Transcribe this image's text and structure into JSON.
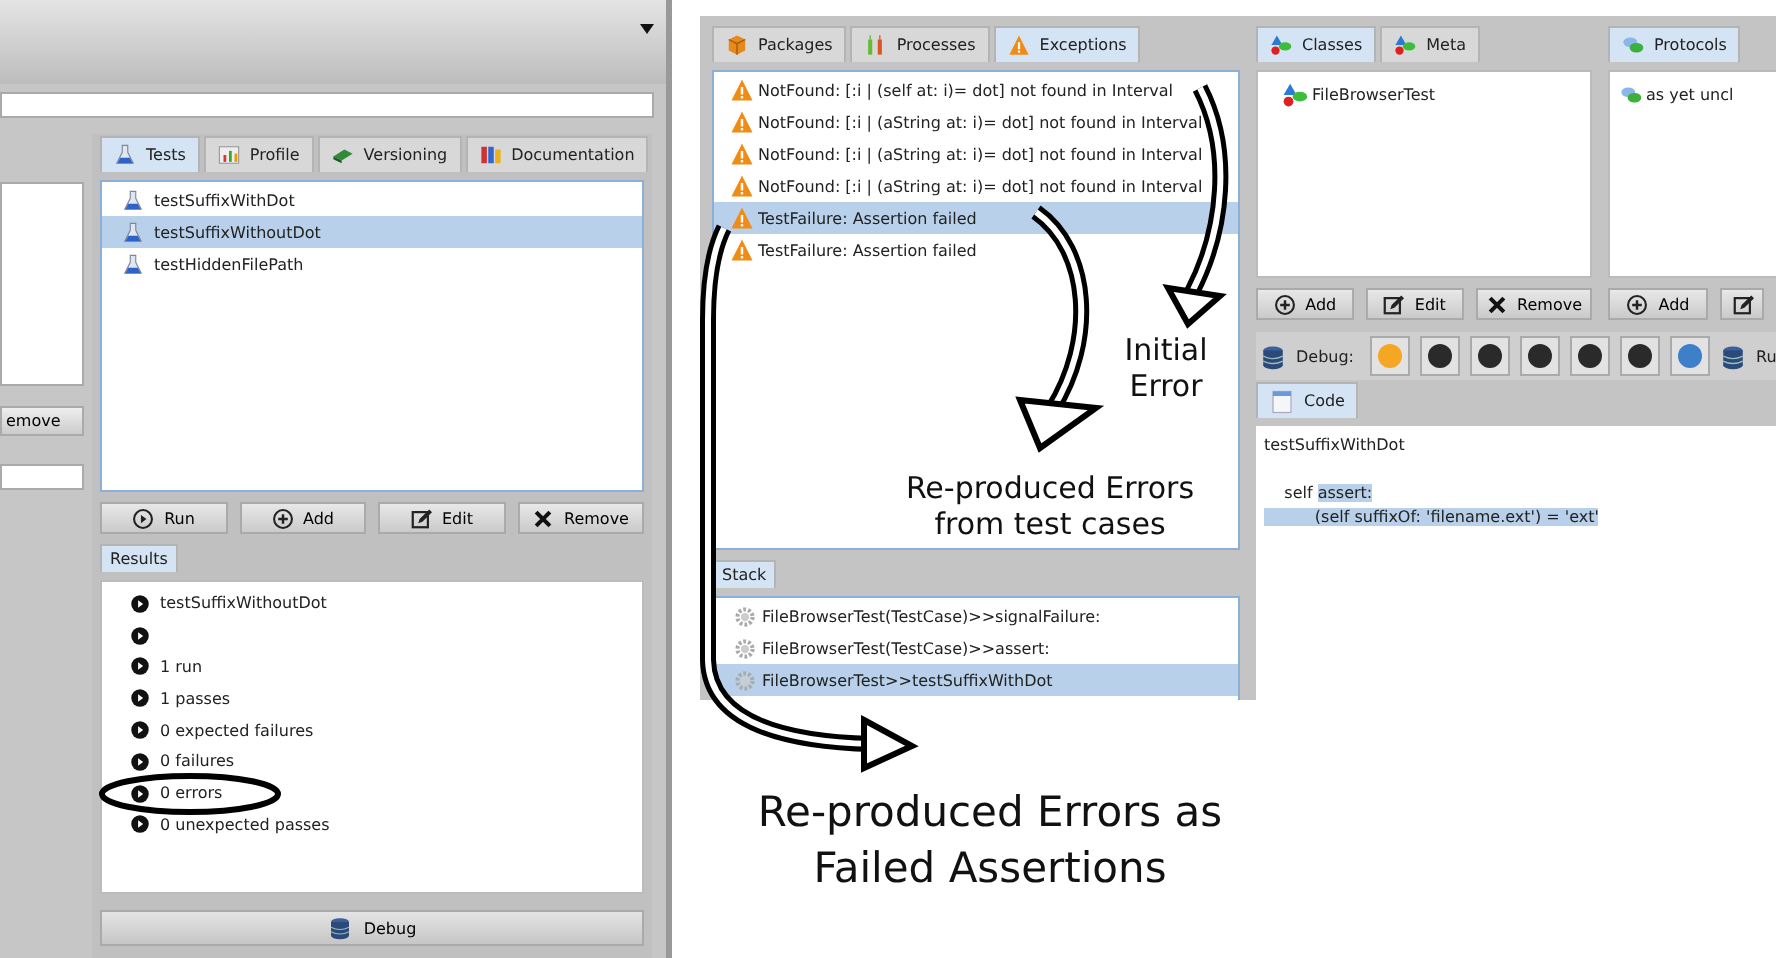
{
  "left_window": {
    "partial_button": "emove",
    "test_tabs": [
      {
        "label": "Tests",
        "selected": true
      },
      {
        "label": "Profile",
        "selected": false
      },
      {
        "label": "Versioning",
        "selected": false
      },
      {
        "label": "Documentation",
        "selected": false
      }
    ],
    "tests": [
      {
        "label": "testSuffixWithDot",
        "selected": false
      },
      {
        "label": "testSuffixWithoutDot",
        "selected": true
      },
      {
        "label": "testHiddenFilePath",
        "selected": false
      }
    ],
    "test_buttons": [
      "Run",
      "Add",
      "Edit",
      "Remove"
    ],
    "results_tab": "Results",
    "results": [
      {
        "kind": "text",
        "text": "testSuffixWithoutDot"
      },
      {
        "kind": "bullet_only"
      },
      {
        "kind": "text",
        "text": "1 run"
      },
      {
        "kind": "text",
        "text": "1 passes"
      },
      {
        "kind": "text",
        "text": "0 expected failures"
      },
      {
        "kind": "text",
        "text": "0 failures"
      },
      {
        "kind": "text",
        "text": "0 errors"
      },
      {
        "kind": "text",
        "text": "0 unexpected passes"
      }
    ],
    "debug_button": "Debug"
  },
  "right_window": {
    "tabs": [
      {
        "label": "Packages",
        "selected": false
      },
      {
        "label": "Processes",
        "selected": false
      },
      {
        "label": "Exceptions",
        "selected": true
      }
    ],
    "exceptions": [
      {
        "text": "NotFound: [:i | (self at: i)= dot] not found in Interval",
        "selected": false
      },
      {
        "text": "NotFound: [:i | (aString at: i)= dot] not found in Interval",
        "selected": false
      },
      {
        "text": "NotFound: [:i | (aString at: i)= dot] not found in Interval",
        "selected": false
      },
      {
        "text": "NotFound: [:i | (aString at: i)= dot] not found in Interval",
        "selected": false
      },
      {
        "text": "TestFailure: Assertion failed",
        "selected": true
      },
      {
        "text": "TestFailure: Assertion failed",
        "selected": false
      }
    ],
    "stack_tab": "Stack",
    "stack": [
      {
        "text": "FileBrowserTest(TestCase)>>signalFailure:",
        "selected": false
      },
      {
        "text": "FileBrowserTest(TestCase)>>assert:",
        "selected": false
      },
      {
        "text": "FileBrowserTest>>testSuffixWithDot",
        "selected": true
      }
    ],
    "class_tabs": [
      {
        "label": "Classes",
        "selected": true
      },
      {
        "label": "Meta",
        "selected": false
      }
    ],
    "classes": [
      "FileBrowserTest"
    ],
    "class_buttons": [
      "Add",
      "Edit",
      "Remove"
    ],
    "protocols_tab": "Protocols",
    "protocols": [
      "as yet uncl"
    ],
    "protocol_buttons": [
      "Add"
    ],
    "debug_label": "Debug:",
    "run_label": "Ru",
    "code_tab": "Code",
    "code_lines": [
      {
        "text": "testSuffixWithDot"
      },
      {
        "text": "    self ",
        "highlighted": "assert:"
      },
      {
        "highlighted": "          (self suffixOf: 'filename.ext') = 'ext'"
      }
    ]
  },
  "annotations": {
    "initial": "Initial Error",
    "test_cases": "Re-produced Errors from test cases",
    "failed": "Re-produced Errors as Failed Assertions"
  }
}
